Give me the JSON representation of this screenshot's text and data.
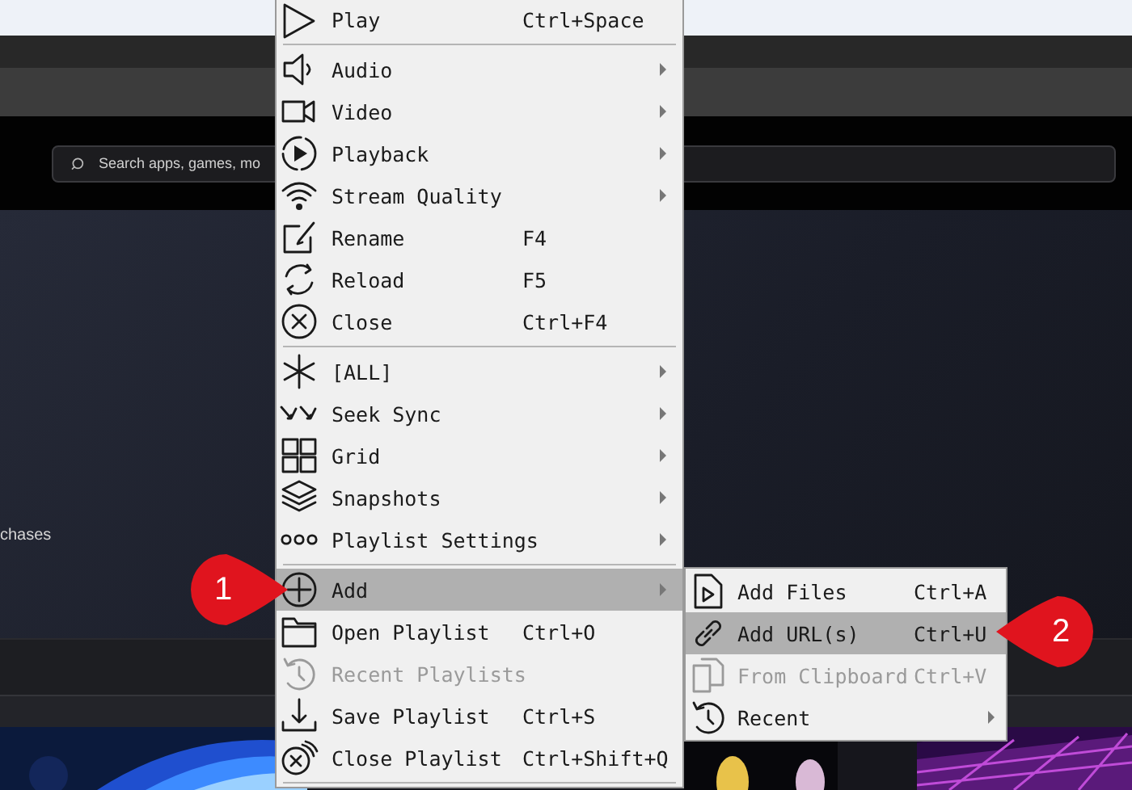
{
  "background": {
    "search": {
      "placeholder": "Search apps, games, mo"
    },
    "side_text": "chases"
  },
  "menu": {
    "sections": [
      [
        {
          "label": "Play",
          "shortcut": "Ctrl+Space",
          "submenu": false,
          "selected": false,
          "disabled": false
        }
      ],
      [
        {
          "label": "Audio",
          "submenu": true,
          "selected": false,
          "disabled": false
        },
        {
          "label": "Video",
          "submenu": true,
          "selected": false,
          "disabled": false
        },
        {
          "label": "Playback",
          "submenu": true,
          "selected": false,
          "disabled": false
        },
        {
          "label": "Stream Quality",
          "submenu": true,
          "selected": false,
          "disabled": false
        },
        {
          "label": "Rename",
          "shortcut": "F4",
          "submenu": false,
          "selected": false,
          "disabled": false
        },
        {
          "label": "Reload",
          "shortcut": "F5",
          "submenu": false,
          "selected": false,
          "disabled": false
        },
        {
          "label": "Close",
          "shortcut": "Ctrl+F4",
          "submenu": false,
          "selected": false,
          "disabled": false
        }
      ],
      [
        {
          "label": "[ALL]",
          "submenu": true,
          "selected": false,
          "disabled": false
        },
        {
          "label": "Seek Sync",
          "submenu": true,
          "selected": false,
          "disabled": false
        },
        {
          "label": "Grid",
          "submenu": true,
          "selected": false,
          "disabled": false
        },
        {
          "label": "Snapshots",
          "submenu": true,
          "selected": false,
          "disabled": false
        },
        {
          "label": "Playlist Settings",
          "submenu": true,
          "selected": false,
          "disabled": false
        }
      ],
      [
        {
          "label": "Add",
          "submenu": true,
          "selected": true,
          "disabled": false
        },
        {
          "label": "Open Playlist",
          "shortcut": "Ctrl+O",
          "submenu": false,
          "selected": false,
          "disabled": false
        },
        {
          "label": "Recent Playlists",
          "submenu": false,
          "selected": false,
          "disabled": true
        },
        {
          "label": "Save Playlist",
          "shortcut": "Ctrl+S",
          "submenu": false,
          "selected": false,
          "disabled": false
        },
        {
          "label": "Close Playlist",
          "shortcut": "Ctrl+Shift+Q",
          "submenu": false,
          "selected": false,
          "disabled": false
        }
      ]
    ]
  },
  "submenu": {
    "items": [
      {
        "label": "Add Files",
        "shortcut": "Ctrl+A",
        "submenu": false,
        "selected": false,
        "disabled": false
      },
      {
        "label": "Add URL(s)",
        "shortcut": "Ctrl+U",
        "submenu": false,
        "selected": true,
        "disabled": false
      },
      {
        "label": "From Clipboard",
        "shortcut": "Ctrl+V",
        "submenu": false,
        "selected": false,
        "disabled": true
      },
      {
        "label": "Recent",
        "submenu": true,
        "selected": false,
        "disabled": false
      }
    ]
  },
  "callouts": [
    {
      "number": "1"
    },
    {
      "number": "2"
    }
  ]
}
